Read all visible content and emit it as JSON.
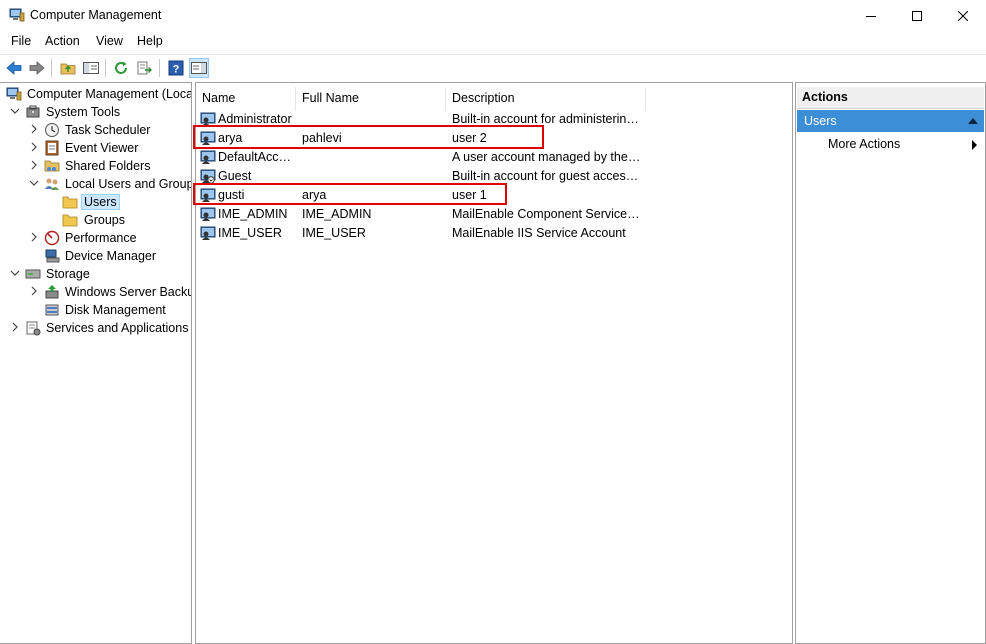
{
  "window": {
    "title": "Computer Management"
  },
  "menu": {
    "file": "File",
    "action": "Action",
    "view": "View",
    "help": "Help"
  },
  "tree": {
    "root": "Computer Management (Local",
    "system_tools": "System Tools",
    "task_scheduler": "Task Scheduler",
    "event_viewer": "Event Viewer",
    "shared_folders": "Shared Folders",
    "local_users_groups": "Local Users and Groups",
    "users": "Users",
    "groups": "Groups",
    "performance": "Performance",
    "device_manager": "Device Manager",
    "storage": "Storage",
    "windows_server_backup": "Windows Server Backup",
    "disk_management": "Disk Management",
    "services_apps": "Services and Applications"
  },
  "list": {
    "columns": [
      "Name",
      "Full Name",
      "Description"
    ],
    "rows": [
      {
        "name": "Administrator",
        "full_name": "",
        "description": "Built-in account for administering..."
      },
      {
        "name": "arya",
        "full_name": "pahlevi",
        "description": "user 2"
      },
      {
        "name": "DefaultAcco...",
        "full_name": "",
        "description": "A user account managed by the s..."
      },
      {
        "name": "Guest",
        "full_name": "",
        "description": "Built-in account for guest access t..."
      },
      {
        "name": "gusti",
        "full_name": "arya",
        "description": "user 1"
      },
      {
        "name": "IME_ADMIN",
        "full_name": "IME_ADMIN",
        "description": "MailEnable Component Services ..."
      },
      {
        "name": "IME_USER",
        "full_name": "IME_USER",
        "description": "MailEnable IIS Service Account"
      }
    ]
  },
  "actions": {
    "header": "Actions",
    "section": "Users",
    "more_actions": "More Actions"
  },
  "colors": {
    "highlight": "#e00000",
    "section_bg": "#3c8fd6",
    "selection": "#cce8ff"
  }
}
